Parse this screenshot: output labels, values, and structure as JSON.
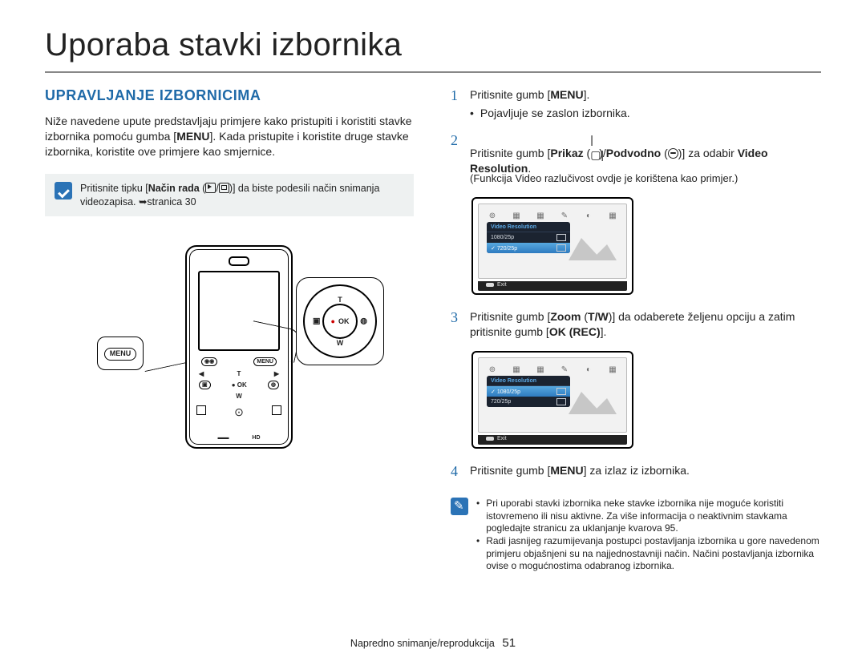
{
  "page": {
    "title": "Uporaba stavki izbornika",
    "section": "UPRAVLJANJE IZBORNICIMA",
    "intro": "Niže navedene upute predstavljaju primjere kako pristupiti i koristiti stavke izbornika pomoću gumba [MENU]. Kada pristupite i koristite druge stavke izbornika, koristite ove primjere kao smjernice.",
    "note1": {
      "prefix": "Pritisnite tipku [",
      "bold": "Način rada",
      "middle": " (",
      "icons_after": ")] da biste podesili način snimanja videozapisa. ➥stranica 30"
    },
    "callouts": {
      "menu": "MENU",
      "dpad_t": "T",
      "dpad_w": "W",
      "dpad_ok": "OK",
      "dpad_rec": "●"
    },
    "steps": [
      {
        "num": "1",
        "line1_pre": "Pritisnite gumb [",
        "line1_bold": "MENU",
        "line1_post": "].",
        "bullet": "Pojavljuje se zaslon izbornika."
      },
      {
        "num": "2",
        "line1_pre": "Pritisnite gumb [",
        "bold1": "Prikaz",
        "mid1": " (",
        "mid2": ")/",
        "bold2": "Podvodno",
        "mid3": " (",
        "mid4": ")] za odabir ",
        "bold3": "Video Resolution",
        "post": ".",
        "para": "(Funkcija Video razlučivost ovdje je korištena kao primjer.)"
      },
      {
        "num": "3",
        "line1_pre": "Pritisnite gumb [",
        "bold1": "Zoom",
        "mid1": " (",
        "bold2": "T/W",
        "mid2": ")] da odaberete željenu opciju a zatim pritisnite gumb [",
        "bold3": "OK (REC)",
        "post": "]."
      },
      {
        "num": "4",
        "line1_pre": "Pritisnite gumb [",
        "bold1": "MENU",
        "post": "] za izlaz iz izbornika."
      }
    ],
    "screens": {
      "head": "Video Resolution",
      "rows": [
        "1080/25p",
        "720/25p"
      ],
      "exit": "Exit"
    },
    "final_notes": [
      "Pri uporabi stavki izbornika neke stavke izbornika nije moguće koristiti istovremeno ili nisu aktivne. Za više informacija o neaktivnim stavkama pogledajte stranicu za uklanjanje kvarova 95.",
      "Radi jasnijeg razumijevanja postupci postavljanja izbornika u gore navedenom primjeru objašnjeni su na najjednostavniji način. Načini postavljanja izbornika ovise o mogućnostima odabranog izbornika."
    ],
    "footer": {
      "label": "Napredno snimanje/reprodukcija",
      "pagenum": "51"
    }
  }
}
